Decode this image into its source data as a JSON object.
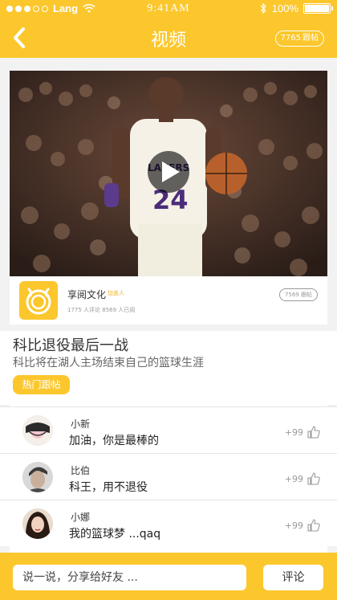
{
  "status_bar": {
    "carrier": "Lang",
    "time": "9:41AM",
    "battery": "100%",
    "battery_level": 1.0
  },
  "header": {
    "title": "视频",
    "follow_count": "7765",
    "follow_label": "跟帖"
  },
  "publisher": {
    "name": "享阅文化",
    "badge": "加盖人",
    "stats": "1775 人评论 8569 人已阅",
    "follow_count": "7569",
    "follow_label": "跟帖"
  },
  "post": {
    "title": "科比退役最后一战",
    "subtitle": "科比将在湖人主场结束自己的篮球生涯",
    "hot_label": "热门跟帖"
  },
  "comments": [
    {
      "name": "小新",
      "text": "加油，你是最棒的",
      "likes": "+99"
    },
    {
      "name": "比伯",
      "text": "科王，用不退役",
      "likes": "+99"
    },
    {
      "name": "小娜",
      "text": "我的篮球梦 ...qaq",
      "likes": "+99"
    }
  ],
  "footer": {
    "placeholder": "说一说，分享给好友 ...",
    "comment_label": "评论"
  },
  "colors": {
    "accent": "#fbc72c"
  }
}
